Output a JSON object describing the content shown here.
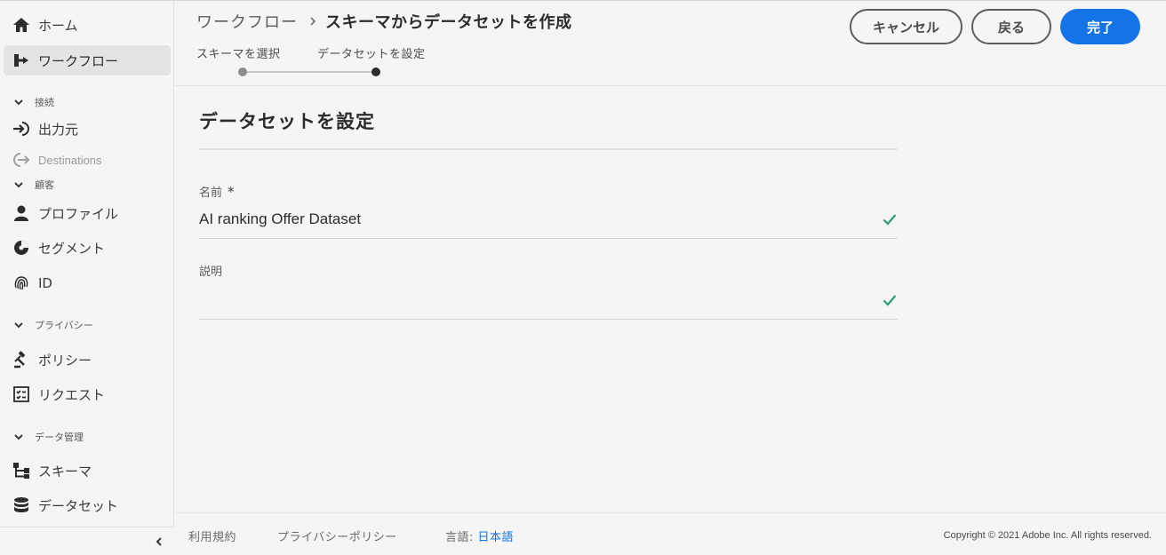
{
  "sidebar": {
    "home": "ホーム",
    "workflows": "ワークフロー",
    "section_connections": "接続",
    "sources": "出力元",
    "destinations": "Destinations",
    "section_customer": "顧客",
    "profiles": "プロファイル",
    "segments": "セグメント",
    "identities": "ID",
    "section_privacy": "プライバシー",
    "policies": "ポリシー",
    "requests": "リクエスト",
    "section_data_management": "データ管理",
    "schemas": "スキーマ",
    "datasets": "データセット"
  },
  "header": {
    "breadcrumb_parent": "ワークフロー",
    "breadcrumb_current": "スキーマからデータセットを作成",
    "steps": [
      "スキーマを選択",
      "データセットを設定"
    ],
    "cancel_label": "キャンセル",
    "back_label": "戻る",
    "finish_label": "完了"
  },
  "form": {
    "title": "データセットを設定",
    "name_label": "名前",
    "name_required_mark": "*",
    "name_value": "AI ranking Offer Dataset",
    "description_label": "説明",
    "description_value": ""
  },
  "footer": {
    "terms": "利用規約",
    "privacy": "プライバシーポリシー",
    "language_label": "言語:",
    "language_value": "日本語",
    "copyright": "Copyright ©  2021 Adobe Inc.  All rights reserved."
  },
  "colors": {
    "accent": "#1473e6",
    "valid_check": "#2d9d78",
    "step_done": "#8e8e8e",
    "step_current": "#2c2c2c"
  },
  "icons": {
    "home": "home-icon",
    "workflows": "workflow-icon",
    "sources": "source-icon",
    "destinations": "destination-icon",
    "profiles": "user-icon",
    "segments": "segment-icon",
    "identities": "fingerprint-icon",
    "policies": "gavel-icon",
    "requests": "checklist-icon",
    "schemas": "schema-icon",
    "datasets": "database-icon"
  }
}
